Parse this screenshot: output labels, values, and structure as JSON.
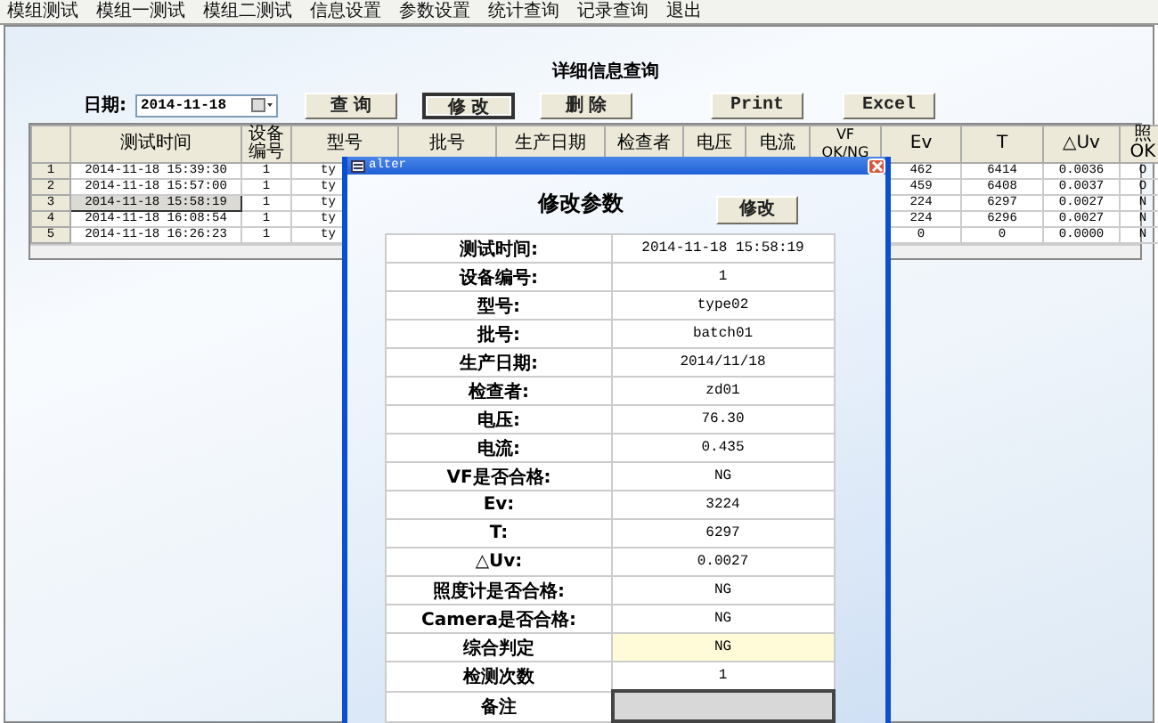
{
  "menu": [
    {
      "label": "模组测试"
    },
    {
      "label": "模组一测试"
    },
    {
      "label": "模组二测试"
    },
    {
      "label": "信息设置"
    },
    {
      "label": "参数设置"
    },
    {
      "label": "统计查询"
    },
    {
      "label": "记录查询"
    },
    {
      "label": "退出"
    }
  ],
  "page_title": "详细信息查询",
  "date_label": "日期:",
  "date_value": "2014-11-18",
  "buttons": [
    {
      "label": "查 询",
      "focused": false
    },
    {
      "label": "修 改",
      "focused": true
    },
    {
      "label": "删 除",
      "focused": false
    }
  ],
  "export_buttons": [
    "Print",
    "Excel"
  ],
  "table": {
    "columns": [
      {
        "label": "测试时间"
      },
      {
        "label": "设备编号"
      },
      {
        "label": "型号"
      },
      {
        "label": "批号"
      },
      {
        "label": "生产日期"
      },
      {
        "label": "检查者"
      },
      {
        "label": "电压"
      },
      {
        "label": "电流"
      },
      {
        "label": "VF OK/NG"
      },
      {
        "label": "Ev"
      },
      {
        "label": "T"
      },
      {
        "label": "△Uv"
      },
      {
        "label": "照 OK"
      }
    ],
    "rows": [
      {
        "left_cells": [
          "1",
          "2014-11-18 15:39:30",
          "1",
          "ty"
        ],
        "right_cells": [
          "462",
          "6414",
          "0.0036",
          "O"
        ],
        "selected": false
      },
      {
        "left_cells": [
          "2",
          "2014-11-18 15:57:00",
          "1",
          "ty"
        ],
        "right_cells": [
          "459",
          "6408",
          "0.0037",
          "O"
        ],
        "selected": false
      },
      {
        "left_cells": [
          "3",
          "2014-11-18 15:58:19",
          "1",
          "ty"
        ],
        "right_cells": [
          "224",
          "6297",
          "0.0027",
          "N"
        ],
        "selected": true
      },
      {
        "left_cells": [
          "4",
          "2014-11-18 16:08:54",
          "1",
          "ty"
        ],
        "right_cells": [
          "224",
          "6296",
          "0.0027",
          "N"
        ],
        "selected": false
      },
      {
        "left_cells": [
          "5",
          "2014-11-18 16:26:23",
          "1",
          "ty"
        ],
        "right_cells": [
          "0",
          "0",
          "0.0000",
          "N"
        ],
        "selected": false
      }
    ]
  },
  "dialog": {
    "title": "alter",
    "heading": "修改参数",
    "button": "修改",
    "fields": [
      {
        "label": "测试时间:",
        "value": "2014-11-18 15:58:19",
        "kind": "text"
      },
      {
        "label": "设备编号:",
        "value": "1",
        "kind": "text"
      },
      {
        "label": "型号:",
        "value": "type02",
        "kind": "text"
      },
      {
        "label": "批号:",
        "value": "batch01",
        "kind": "text"
      },
      {
        "label": "生产日期:",
        "value": "2014/11/18",
        "kind": "text"
      },
      {
        "label": "检查者:",
        "value": "zd01",
        "kind": "text"
      },
      {
        "label": "电压:",
        "value": "76.30",
        "kind": "text"
      },
      {
        "label": "电流:",
        "value": "0.435",
        "kind": "text"
      },
      {
        "label": "VF是否合格:",
        "value": "NG",
        "kind": "text"
      },
      {
        "label": "Ev:",
        "value": "3224",
        "kind": "text"
      },
      {
        "label": "T:",
        "value": "6297",
        "kind": "text"
      },
      {
        "label": "△Uv:",
        "value": "0.0027",
        "kind": "text"
      },
      {
        "label": "照度计是否合格:",
        "value": "NG",
        "kind": "text"
      },
      {
        "label": "Camera是否合格:",
        "value": "NG",
        "kind": "text"
      },
      {
        "label": "综合判定",
        "value": "NG",
        "kind": "highlight"
      },
      {
        "label": "检测次数",
        "value": "1",
        "kind": "text"
      },
      {
        "label": "备注",
        "kind": "input"
      }
    ]
  }
}
